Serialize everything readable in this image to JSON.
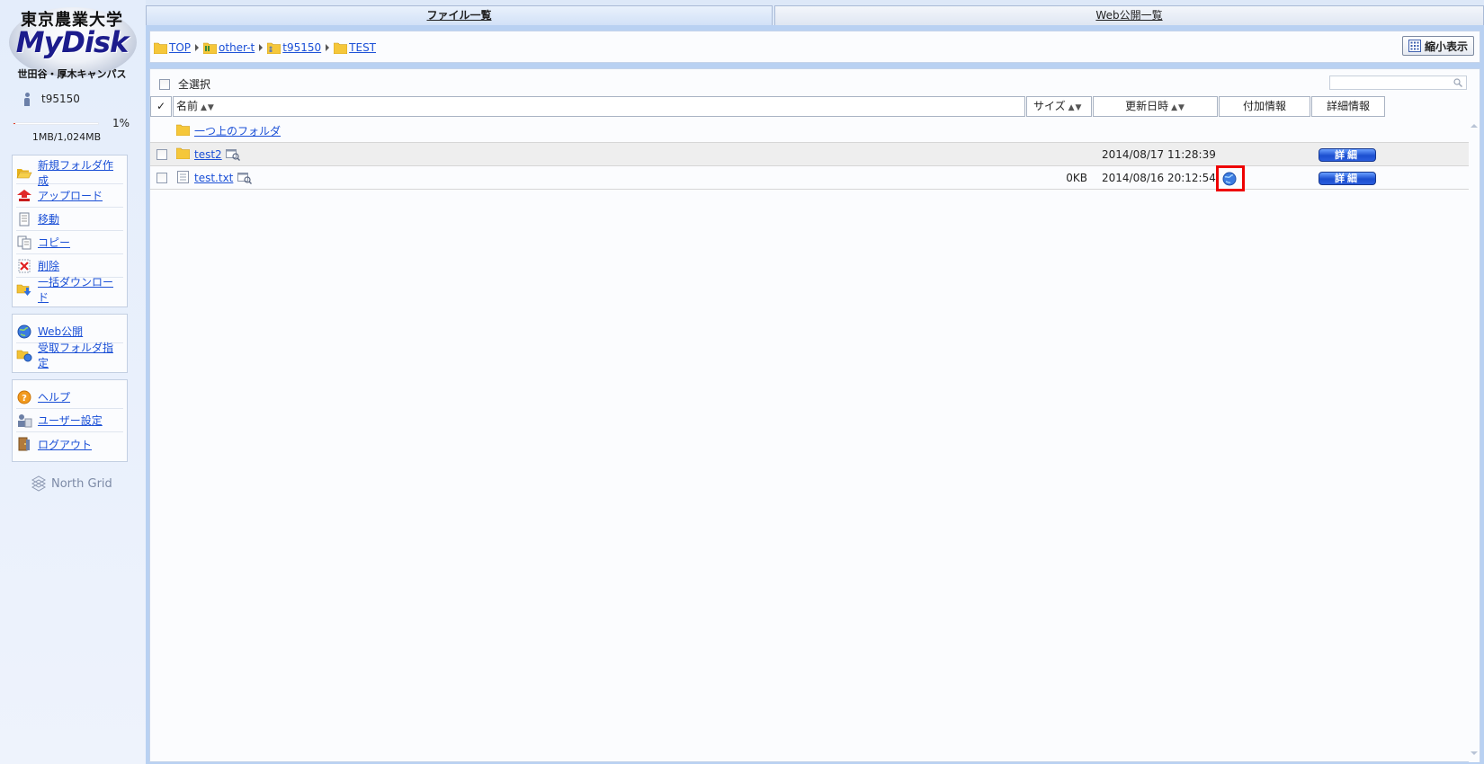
{
  "logo": {
    "top_text": "東京農業大学",
    "main_text": "MyDisk",
    "bottom_text": "世田谷・厚木キャンパス"
  },
  "user": {
    "name": "t95150"
  },
  "quota": {
    "percent_label": "1%",
    "fraction": 0.01,
    "usage": "1MB/1,024MB"
  },
  "menu": {
    "file_ops": [
      {
        "label": "新規フォルダ作成",
        "icon": "new-folder-icon"
      },
      {
        "label": "アップロード",
        "icon": "upload-icon"
      },
      {
        "label": "移動",
        "icon": "move-icon"
      },
      {
        "label": "コピー",
        "icon": "copy-icon"
      },
      {
        "label": "削除",
        "icon": "delete-icon"
      },
      {
        "label": "一括ダウンロード",
        "icon": "bulk-download-icon"
      }
    ],
    "web_ops": [
      {
        "label": "Web公開",
        "icon": "globe-icon"
      },
      {
        "label": "受取フォルダ指定",
        "icon": "receive-folder-icon"
      }
    ],
    "misc": [
      {
        "label": "ヘルプ",
        "icon": "help-icon"
      },
      {
        "label": "ユーザー設定",
        "icon": "user-settings-icon"
      },
      {
        "label": "ログアウト",
        "icon": "logout-icon"
      }
    ]
  },
  "brand": {
    "label": "North Grid"
  },
  "tabs": {
    "files": "ファイル一覧",
    "web": "Web公開一覧"
  },
  "breadcrumb": [
    "TOP",
    "other-t",
    "t95150",
    "TEST"
  ],
  "toolbar": {
    "shrink_label": "縮小表示"
  },
  "list": {
    "select_all": "全選択",
    "columns": {
      "check": "✓",
      "name": "名前",
      "size": "サイズ",
      "modified": "更新日時",
      "extra": "付加情報",
      "detail": "詳細情報"
    },
    "sort_arrows": "▲▼",
    "parent_link": "一つ上のフォルダ",
    "rows": [
      {
        "name": "test2",
        "type": "folder",
        "size": "",
        "modified": "2014/08/17 11:28:39",
        "web_published": false,
        "detail_label": "詳細"
      },
      {
        "name": "test.txt",
        "type": "file",
        "size": "0KB",
        "modified": "2014/08/16 20:12:54",
        "web_published": true,
        "detail_label": "詳細"
      }
    ]
  },
  "colors": {
    "accent_blue": "#1a4fd6",
    "panel_border": "#b9d1f2",
    "highlight": "#ee0000",
    "quota_fill": "#e23a2a"
  }
}
